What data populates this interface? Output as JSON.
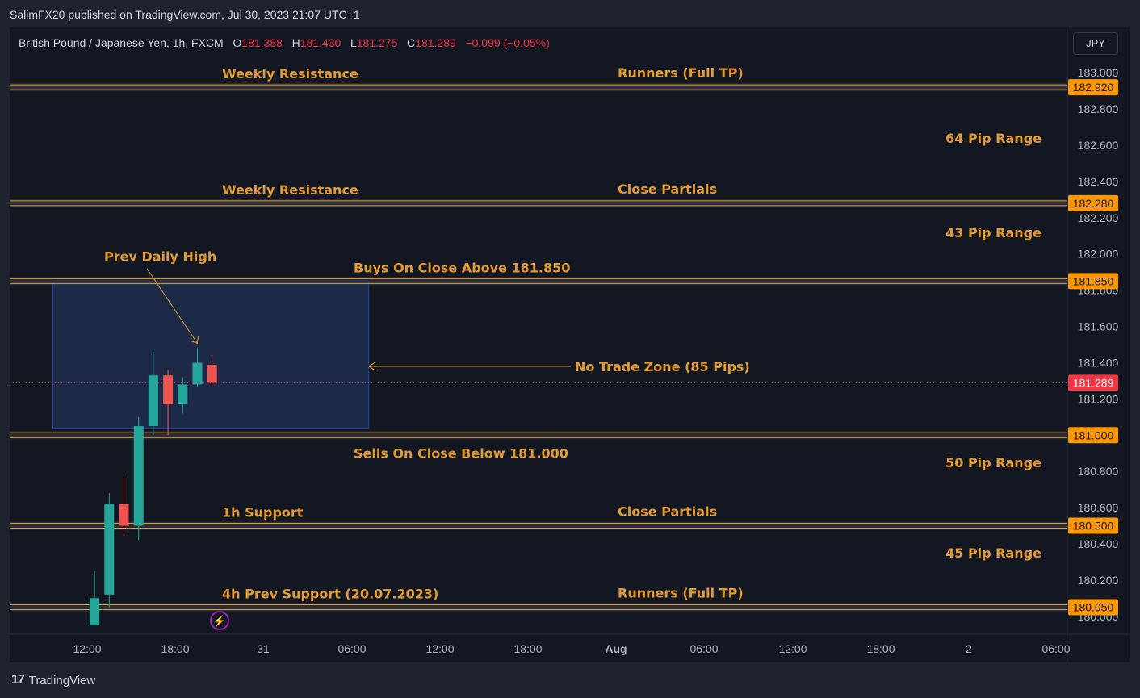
{
  "header": {
    "publisher": "SalimFX20 published on TradingView.com, Jul 30, 2023 21:07 UTC+1"
  },
  "symbol": {
    "name": "British Pound / Japanese Yen, 1h, FXCM",
    "o_label": "O",
    "o": "181.388",
    "h_label": "H",
    "h": "181.430",
    "l_label": "L",
    "l": "181.275",
    "c_label": "C",
    "c": "181.289",
    "change": "−0.099 (−0.05%)"
  },
  "currency_button": "JPY",
  "footer": {
    "brand": "TradingView",
    "mark": "17"
  },
  "colors": {
    "background": "#131722",
    "up": "#26a69a",
    "down": "#ef5350",
    "annotation": "#e39b32",
    "level_tag": "#ff9800",
    "last_price": "#f23645",
    "zone": "#1e2d4d"
  },
  "chart_data": {
    "type": "candlestick",
    "symbol": "GBPJPY",
    "timeframe": "1h",
    "ylim": [
      179.95,
      183.05
    ],
    "y_ticks": [
      "183.000",
      "182.800",
      "182.600",
      "182.400",
      "182.200",
      "182.000",
      "181.800",
      "181.600",
      "181.400",
      "181.200",
      "180.800",
      "180.600",
      "180.400",
      "180.200",
      "180.000"
    ],
    "x_ticks": [
      "12:00",
      "18:00",
      "31",
      "06:00",
      "12:00",
      "18:00",
      "Aug",
      "06:00",
      "12:00",
      "18:00",
      "2",
      "06:00"
    ],
    "candles": [
      {
        "t": 12.5,
        "o": 179.95,
        "h": 180.25,
        "l": 179.95,
        "c": 180.1
      },
      {
        "t": 13.5,
        "o": 180.12,
        "h": 180.68,
        "l": 180.05,
        "c": 180.62
      },
      {
        "t": 14.5,
        "o": 180.62,
        "h": 180.78,
        "l": 180.45,
        "c": 180.5
      },
      {
        "t": 15.5,
        "o": 180.5,
        "h": 181.1,
        "l": 180.42,
        "c": 181.05
      },
      {
        "t": 16.5,
        "o": 181.05,
        "h": 181.46,
        "l": 181.0,
        "c": 181.33
      },
      {
        "t": 17.5,
        "o": 181.33,
        "h": 181.36,
        "l": 181.0,
        "c": 181.17
      },
      {
        "t": 18.5,
        "o": 181.17,
        "h": 181.32,
        "l": 181.12,
        "c": 181.28
      },
      {
        "t": 19.5,
        "o": 181.28,
        "h": 181.48,
        "l": 181.27,
        "c": 181.4
      },
      {
        "t": 20.5,
        "o": 181.388,
        "h": 181.43,
        "l": 181.275,
        "c": 181.289
      }
    ],
    "last_price": "181.289",
    "levels": [
      {
        "price": 182.92,
        "tag": "182.920",
        "left": "Weekly Resistance",
        "right": "Runners (Full TP)"
      },
      {
        "price": 182.28,
        "tag": "182.280",
        "left": "Weekly Resistance",
        "right": "Close Partials"
      },
      {
        "price": 181.85,
        "tag": "181.850",
        "left": "Buys On Close Above 181.850",
        "right": ""
      },
      {
        "price": 181.0,
        "tag": "181.000",
        "left": "Sells On Close Below 181.000",
        "right": ""
      },
      {
        "price": 180.5,
        "tag": "180.500",
        "left": "1h Support",
        "right": "Close Partials"
      },
      {
        "price": 180.05,
        "tag": "180.050",
        "left": "4h Prev Support (20.07.2023)",
        "right": "Runners (Full TP)"
      }
    ],
    "ranges": [
      {
        "price": 182.64,
        "label": "64 Pip Range"
      },
      {
        "price": 182.12,
        "label": "43 Pip Range"
      },
      {
        "price": 180.85,
        "label": "50 Pip Range"
      },
      {
        "price": 180.35,
        "label": "45 Pip Range"
      }
    ],
    "zone": {
      "y_top": 181.85,
      "y_bottom": 181.04,
      "t_start": 9.5,
      "t_end": 31,
      "label": "No Trade Zone (85 Pips)",
      "label_price": 181.38
    },
    "callout": {
      "label": "Prev Daily High",
      "label_price": 181.96,
      "label_t": 13.5,
      "target_t": 19.5,
      "target_price": 181.48
    }
  }
}
